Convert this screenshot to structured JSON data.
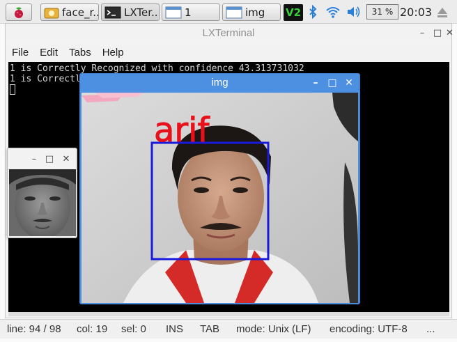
{
  "panel": {
    "taskbar": [
      {
        "label": "face_r...",
        "icon": "file-manager-icon"
      },
      {
        "label": "LXTer...",
        "icon": "terminal-icon"
      },
      {
        "label": "1",
        "icon": "window-icon"
      },
      {
        "label": "img",
        "icon": "window-icon"
      }
    ],
    "vnc_label": "V2",
    "cpu": "31 %",
    "clock": "20:03"
  },
  "terminal": {
    "title": "LXTerminal",
    "menu": [
      "File",
      "Edit",
      "Tabs",
      "Help"
    ],
    "lines": [
      "1 is Correctly Recognized with confidence 43.313731032",
      "1 is Correctly"
    ]
  },
  "img_window": {
    "title": "img",
    "detected_name": "arif",
    "box_color": "#1a1adc",
    "name_color": "#e8101a"
  },
  "status": {
    "line": "line: 94 / 98",
    "col": "col: 19",
    "sel": "sel: 0",
    "ins": "INS",
    "tab": "TAB",
    "mode": "mode: Unix (LF)",
    "encoding": "encoding: UTF-8",
    "more": "..."
  },
  "colors": {
    "titlebar_active": "#4d8fe0",
    "terminal_bg": "#000000"
  }
}
